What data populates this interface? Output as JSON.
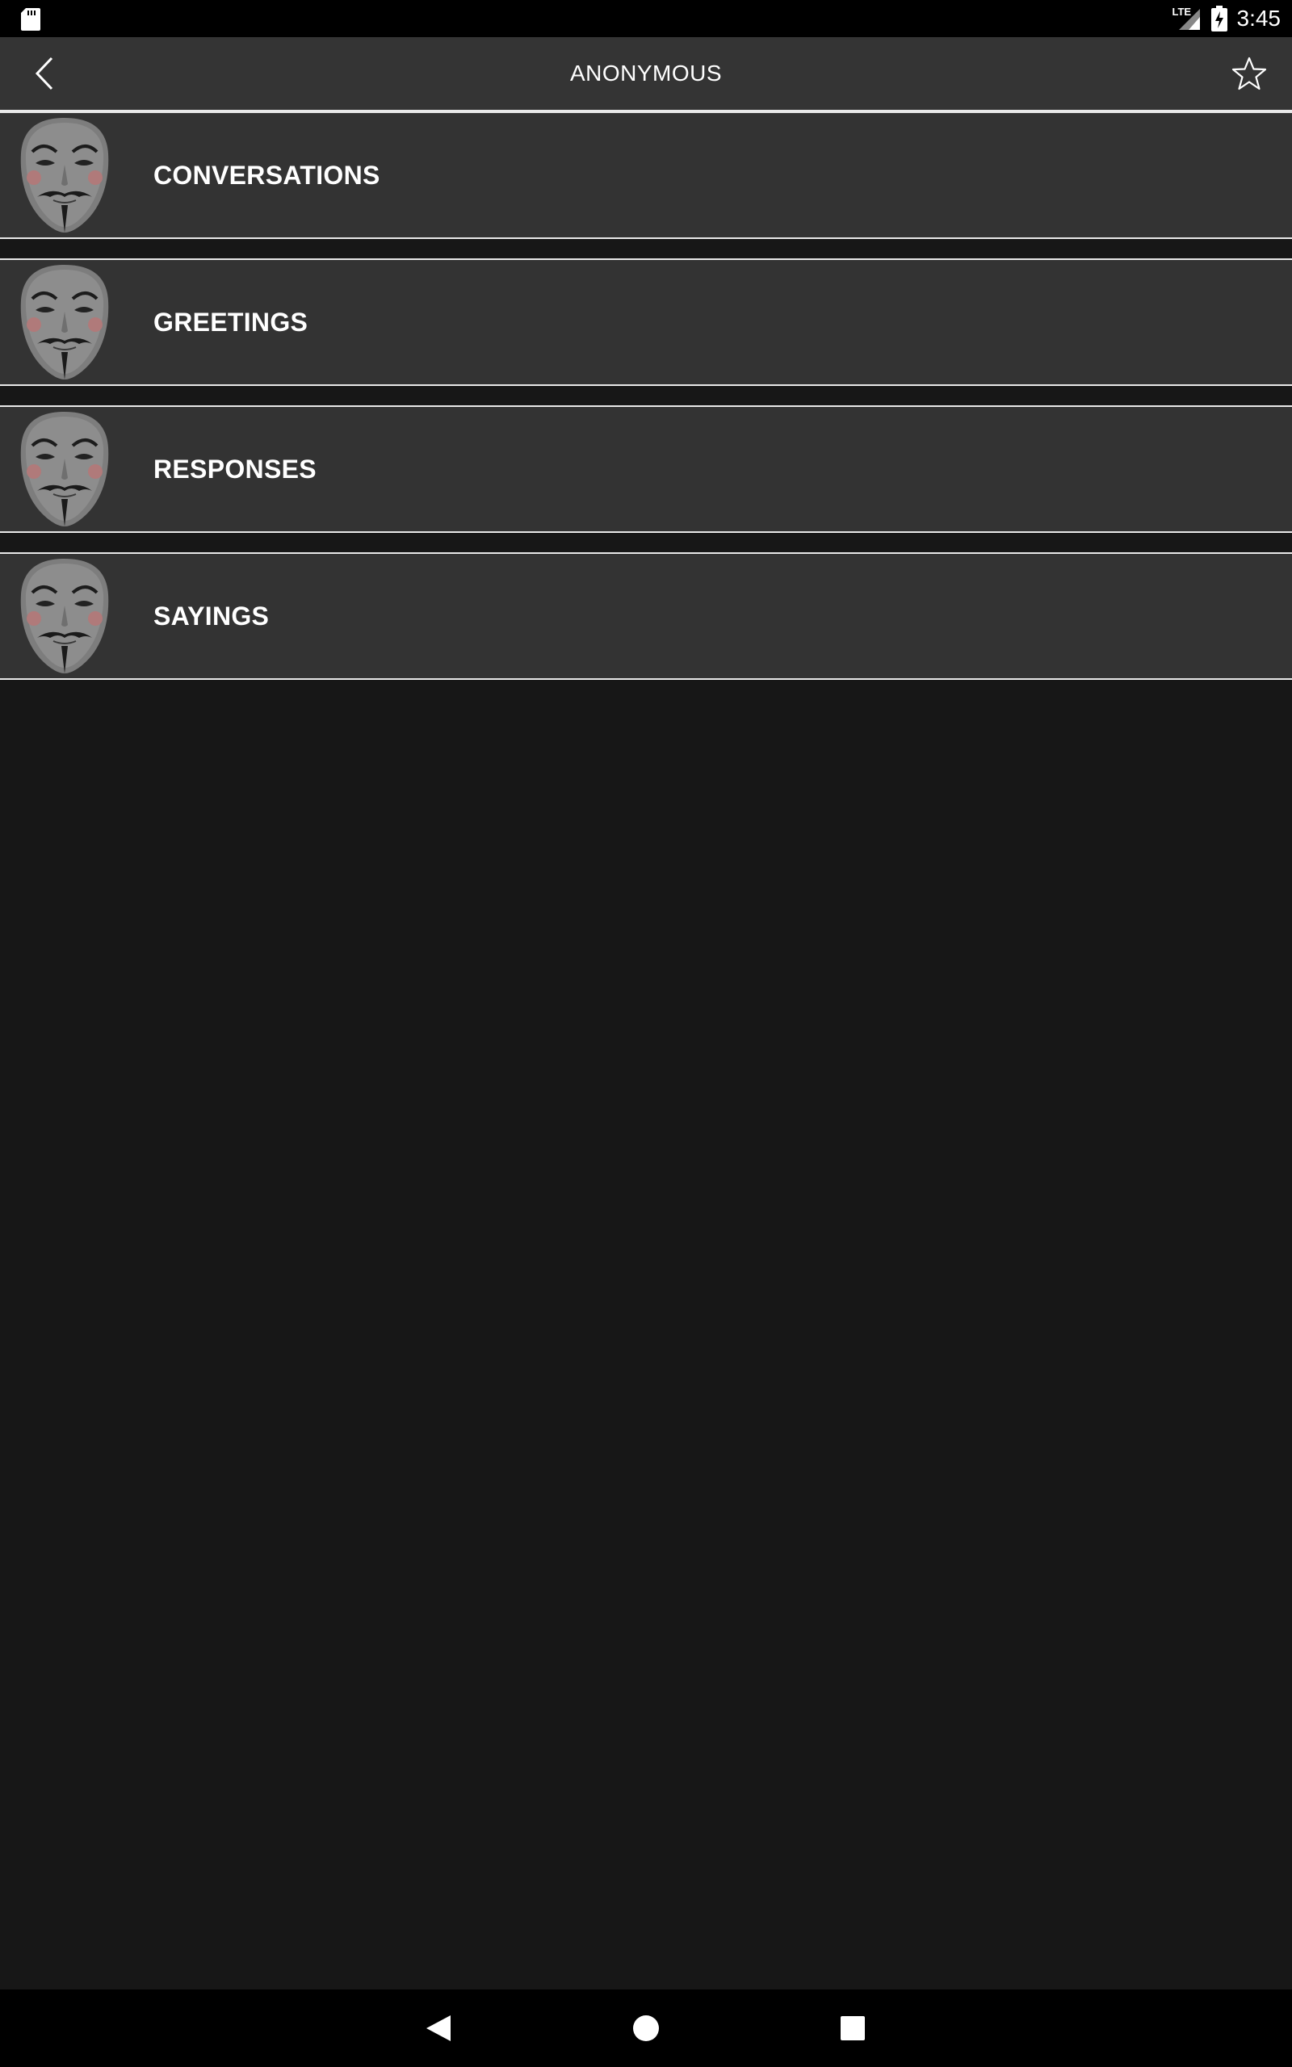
{
  "status_bar": {
    "network": "LTE",
    "time": "3:45",
    "icons": [
      "sd-card-icon",
      "signal-icon",
      "battery-charging-icon"
    ]
  },
  "app_bar": {
    "title": "ANONYMOUS",
    "icons": [
      "back-arrow-icon",
      "star-outline-icon"
    ]
  },
  "list": {
    "items": [
      {
        "label": "CONVERSATIONS",
        "icon": "guy-fawkes-mask-icon"
      },
      {
        "label": "GREETINGS",
        "icon": "guy-fawkes-mask-icon"
      },
      {
        "label": "RESPONSES",
        "icon": "guy-fawkes-mask-icon"
      },
      {
        "label": "SAYINGS",
        "icon": "guy-fawkes-mask-icon"
      }
    ]
  },
  "nav_bar": {
    "icons": [
      "nav-back-icon",
      "nav-home-icon",
      "nav-recents-icon"
    ]
  },
  "colors": {
    "background": "#171717",
    "app_bar": "#343434",
    "list_item": "#333333",
    "divider": "#e9e9e9",
    "text": "#ffffff"
  }
}
